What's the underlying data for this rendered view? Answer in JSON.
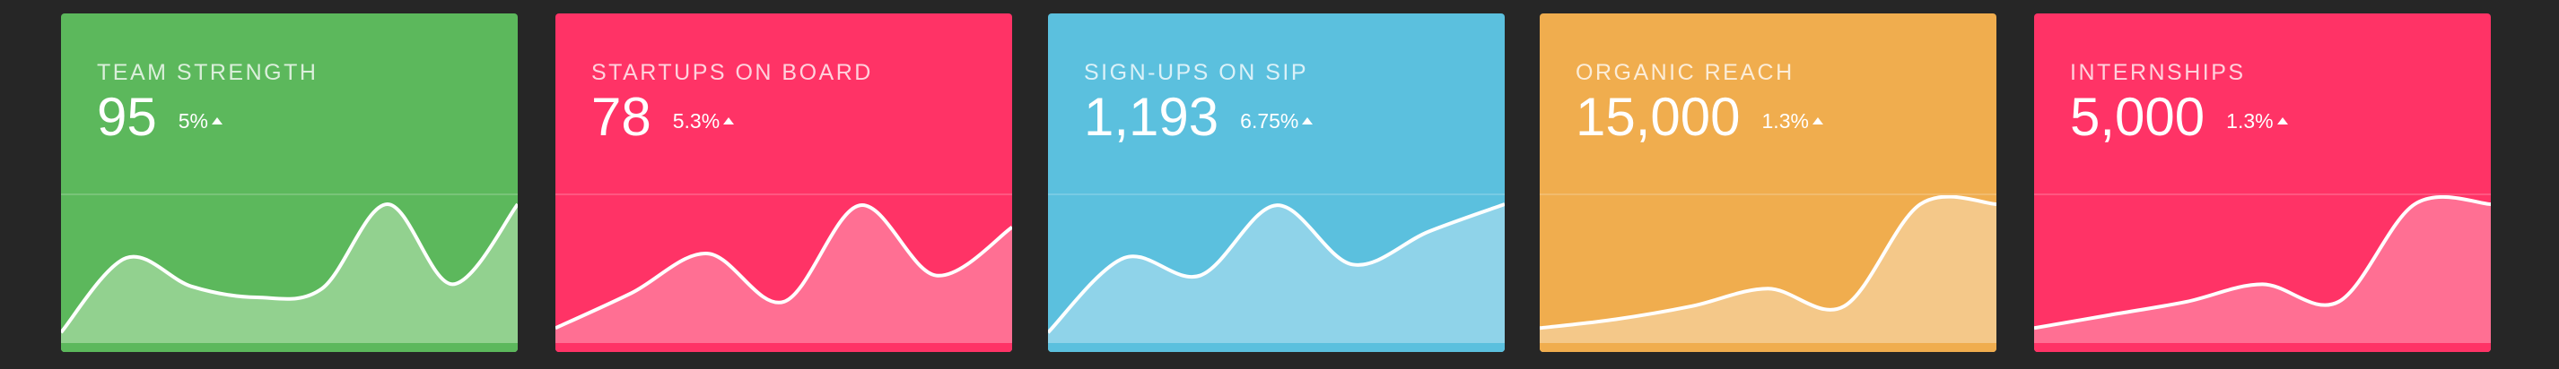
{
  "cards": [
    {
      "title": "TEAM STRENGTH",
      "value": "95",
      "change": "5%",
      "trend_icon": "up-arrow-icon",
      "bg": "#5cb85c",
      "fill": "#92d18f",
      "stroke": "#ffffff",
      "bottom": "#5cb85c",
      "chart_data": {
        "type": "area",
        "values": [
          4,
          38,
          25,
          20,
          24,
          68,
          26,
          72
        ]
      }
    },
    {
      "title": "STARTUPS ON BOARD",
      "value": "78",
      "change": "5.3%",
      "trend_icon": "up-arrow-icon",
      "bg": "#ff3366",
      "fill": "#ff6f93",
      "stroke": "#ffffff",
      "bottom": "#ff3366",
      "chart_data": {
        "type": "area",
        "values": [
          6,
          22,
          40,
          18,
          62,
          30,
          52
        ]
      }
    },
    {
      "title": "SIGN-UPS ON SIP",
      "value": "1,193",
      "change": "6.75%",
      "trend_icon": "up-arrow-icon",
      "bg": "#5bc0de",
      "fill": "#8fd3e9",
      "stroke": "#ffffff",
      "bottom": "#5bc0de",
      "chart_data": {
        "type": "area",
        "values": [
          4,
          38,
          30,
          62,
          35,
          50,
          70
        ]
      }
    },
    {
      "title": "ORGANIC REACH",
      "value": "15,000",
      "change": "1.3%",
      "trend_icon": "up-arrow-icon",
      "bg": "#f0ad4e",
      "fill": "#f4c889",
      "stroke": "#ffffff",
      "bottom": "#f0ad4e",
      "chart_data": {
        "type": "area",
        "values": [
          6,
          10,
          16,
          24,
          16,
          64,
          72
        ]
      }
    },
    {
      "title": "INTERNSHIPS",
      "value": "5,000",
      "change": "1.3%",
      "trend_icon": "up-arrow-icon",
      "bg": "#ff3366",
      "fill": "#ff6f93",
      "stroke": "#ffffff",
      "bottom": "#ff3366",
      "chart_data": {
        "type": "area",
        "values": [
          6,
          12,
          18,
          26,
          18,
          66,
          74
        ]
      }
    }
  ]
}
